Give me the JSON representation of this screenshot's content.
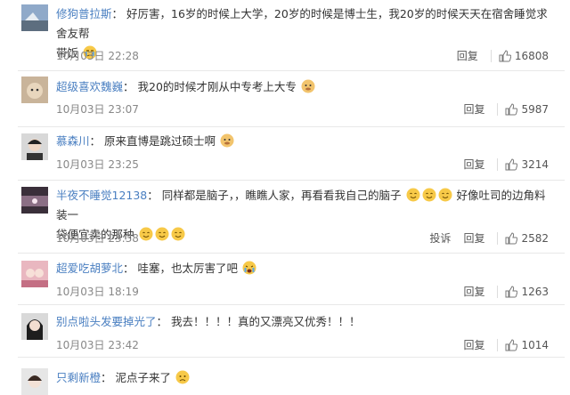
{
  "comments": [
    {
      "username": "修狗普拉斯",
      "text_line1": "好厉害，16岁的时候上大学，20岁的时候是博士生，我20岁的时候天天在宿舍睡觉求舍友帮",
      "text_line2": "带饭",
      "emojis": [
        "crying-emoji"
      ],
      "time": "10月03日 22:28",
      "actions": [
        "回复"
      ],
      "likes": "16808"
    },
    {
      "username": "超级喜欢魏巍",
      "text_line1": "我20的时候才刚从中专考上大专",
      "emojis": [
        "doge-emoji"
      ],
      "time": "10月03日 23:07",
      "actions": [
        "回复"
      ],
      "likes": "5987"
    },
    {
      "username": "慕森川",
      "text_line1": "原来直博是跳过硕士啊",
      "emojis": [
        "doge-emoji"
      ],
      "time": "10月03日 23:25",
      "actions": [
        "回复"
      ],
      "likes": "3214"
    },
    {
      "username": "半夜不睡觉12138",
      "text_line1": "同样都是脑子，，瞧瞧人家，再看看我自己的脑子",
      "text_line1b": "好像吐司的边角料装一",
      "text_line2": "袋便宜卖的那种",
      "emojis": [
        "smile-emoji"
      ],
      "time": "10月03日 23:38",
      "actions": [
        "投诉",
        "回复"
      ],
      "likes": "2582"
    },
    {
      "username": "超爱吃胡萝北",
      "text_line1": "哇塞，也太厉害了吧",
      "emojis": [
        "tears-emoji"
      ],
      "time": "10月03日 18:19",
      "actions": [
        "回复"
      ],
      "likes": "1263"
    },
    {
      "username": "别点啦头发要掉光了",
      "text_line1": "我去！！！！真的又漂亮又优秀！！！",
      "time": "10月03日 23:42",
      "actions": [
        "回复"
      ],
      "likes": "1014"
    },
    {
      "username": "只剩新橙",
      "text_line1": "泥点子来了",
      "emojis": [
        "sad-emoji"
      ]
    }
  ],
  "colors": {
    "username": "#4a7fc1",
    "text": "#333333",
    "meta": "#888888",
    "separator": "#e8e8e8"
  }
}
